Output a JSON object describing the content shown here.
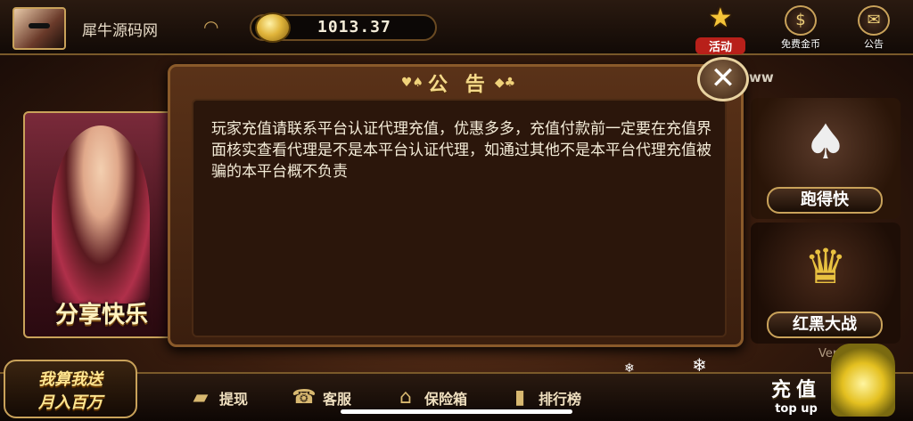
{
  "header": {
    "username": "犀牛源码网",
    "balance": "1013.37",
    "buttons": [
      {
        "label": "活动",
        "icon": "star-icon"
      },
      {
        "label": "免费金币",
        "icon": "coin-s-icon"
      },
      {
        "label": "公告",
        "icon": "mail-icon"
      }
    ]
  },
  "left_panel": {
    "label": "分享快乐"
  },
  "dialog": {
    "title": "公 告",
    "message": "玩家充值请联系平台认证代理充值，优惠多多，充值付款前一定要在充值界面核实查看代理是不是本平台认证代理，如通过其他不是本平台代理充值被骗的本平台概不负责"
  },
  "games": [
    {
      "label": "跑得快",
      "icon": "spade-card-icon"
    },
    {
      "label": "红黑大战",
      "icon": "crown-vs-icon"
    }
  ],
  "watermark_text": "ww",
  "version": "Ver:…7515",
  "promo": {
    "line1": "我算我送",
    "line2": "月入百万"
  },
  "bottom_nav": [
    {
      "label": "提现",
      "icon": "withdraw-icon"
    },
    {
      "label": "客服",
      "icon": "service-icon"
    },
    {
      "label": "保险箱",
      "icon": "bank-icon"
    },
    {
      "label": "排行榜",
      "icon": "ranking-icon"
    }
  ],
  "topup": {
    "label_cn": "充值",
    "label_en": "top up"
  }
}
